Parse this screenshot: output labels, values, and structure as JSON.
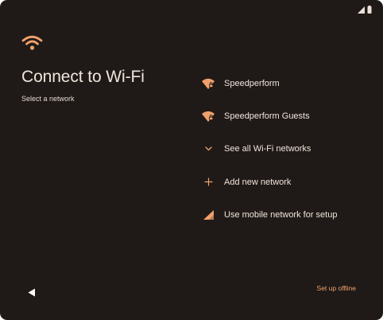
{
  "colors": {
    "background": "#1f1a17",
    "accent": "#f0a06c",
    "text": "#f1e4dc"
  },
  "status_bar": {
    "icons": [
      "cellular-signal-icon",
      "battery-icon"
    ]
  },
  "header": {
    "icon": "wifi-icon",
    "title": "Connect to Wi-Fi",
    "subtitle": "Select a network"
  },
  "networks": [
    {
      "label": "Speedperform",
      "icon": "wifi-lock-icon"
    },
    {
      "label": "Speedperform Guests",
      "icon": "wifi-lock-icon"
    },
    {
      "label": "See all Wi-Fi networks",
      "icon": "chevron-down-icon"
    },
    {
      "label": "Add new network",
      "icon": "plus-icon"
    },
    {
      "label": "Use mobile network for setup",
      "icon": "cellular-signal-icon"
    }
  ],
  "footer": {
    "back_icon": "back-triangle-icon",
    "offline_label": "Set up offline"
  }
}
